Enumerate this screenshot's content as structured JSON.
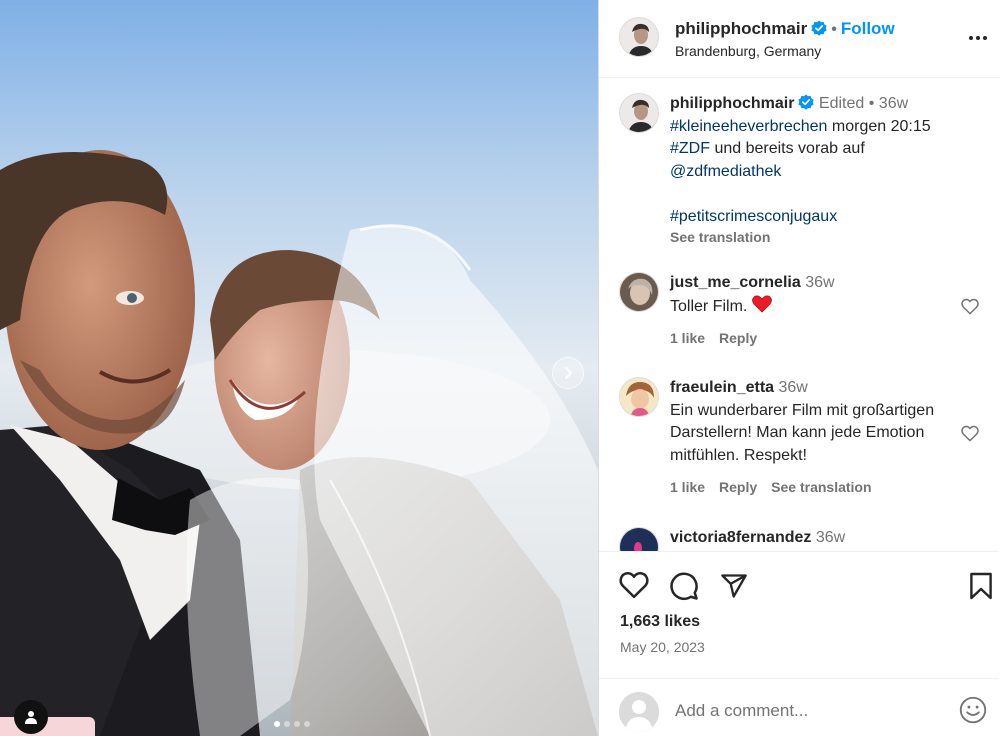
{
  "post": {
    "username": "philipphochmair",
    "follow_label": "Follow",
    "location": "Brandenburg, Germany",
    "image_count": 4,
    "active_image": 1
  },
  "caption": {
    "username": "philipphochmair",
    "edited": "Edited",
    "time": "36w",
    "hashtag1": "#kleineeheverbrechen",
    "text1": " morgen 20:15",
    "hashtag2": "#ZDF",
    "text2": " und bereits vorab auf",
    "mention": "@zdfmediathek",
    "hashtag3": "#petitscrimesconjugaux",
    "see_translation": "See translation"
  },
  "comments": [
    {
      "username": "just_me_cornelia",
      "time": "36w",
      "text": "Toller Film. ",
      "emoji": "heart-emoji",
      "likes": "1 like",
      "reply": "Reply"
    },
    {
      "username": "fraeulein_etta",
      "time": "36w",
      "text": "Ein wunderbarer Film mit großartigen Darstellern! Man kann jede Emotion mitfühlen. Respekt!",
      "likes": "1 like",
      "reply": "Reply",
      "see_translation": "See translation"
    },
    {
      "username": "victoria8fernandez",
      "time": "36w"
    }
  ],
  "actions": {
    "likes": "1,663 likes",
    "date": "May 20, 2023",
    "comment_placeholder": "Add a comment..."
  },
  "colors": {
    "link": "#00376b",
    "follow": "#0095f6",
    "verified": "#0095f6",
    "heart": "#ed1c24"
  }
}
